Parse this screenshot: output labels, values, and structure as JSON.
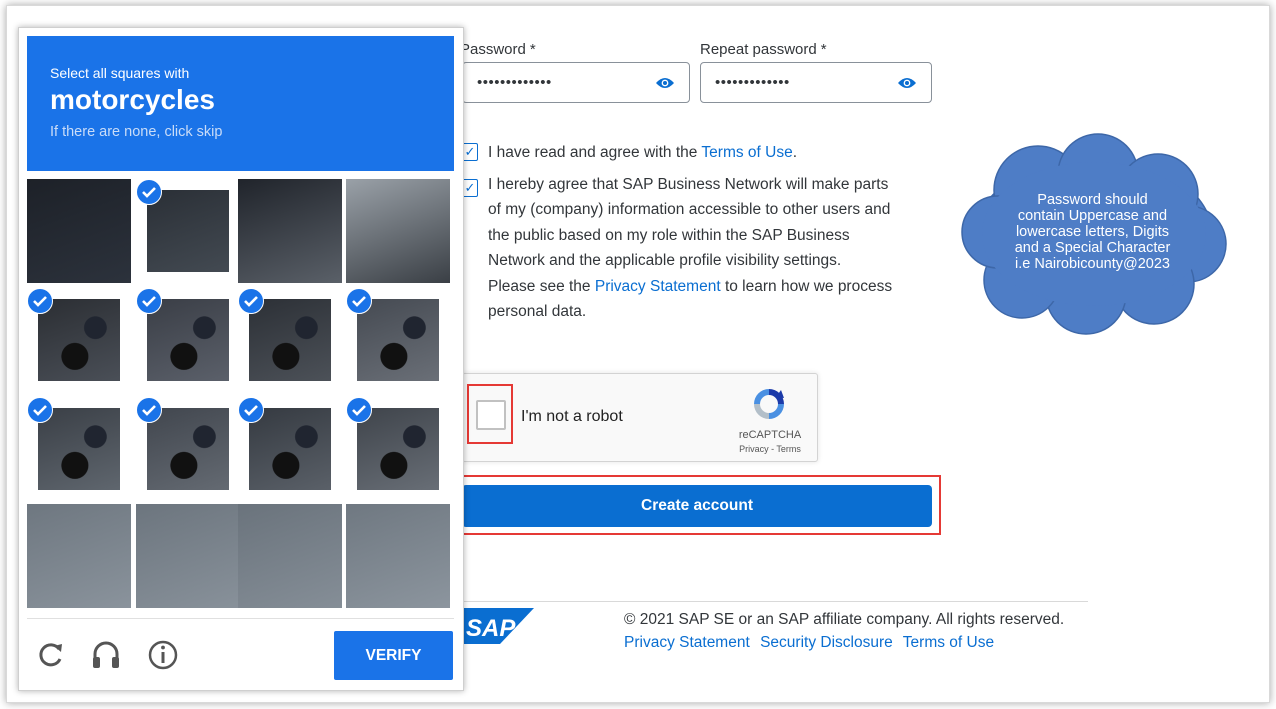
{
  "form": {
    "password_label": "Password",
    "password_required": "*",
    "password_value": "•••••••••••••",
    "repeat_label": "Repeat password",
    "repeat_required": "*",
    "repeat_value": "•••••••••••••",
    "checkbox_mark": "✓",
    "terms_prefix": "I have read and agree with the ",
    "terms_link": "Terms of Use",
    "terms_suffix": ".",
    "consent_lines": [
      "I hereby agree that SAP Business Network will make parts",
      "of my (company) information accessible to other users and",
      "the public based on my role within the SAP Business",
      "Network and the applicable profile visibility settings."
    ],
    "consent_see": "Please see the ",
    "consent_link": "Privacy Statement",
    "consent_after": " to learn how we process",
    "consent_last": "personal data.",
    "create_button": "Create account"
  },
  "recaptcha": {
    "label": "I'm not a robot",
    "brand": "reCAPTCHA",
    "links": "Privacy - Terms"
  },
  "footer": {
    "logo_text": "SAP",
    "copyright": "© 2021 SAP SE or an SAP affiliate company. All rights reserved.",
    "links": [
      "Privacy Statement",
      "Security Disclosure",
      "Terms of Use"
    ]
  },
  "note": {
    "lines": [
      "Password should",
      "contain Uppercase and",
      "lowercase letters, Digits",
      "and a Special Character",
      "i.e Nairobicounty@2023"
    ]
  },
  "challenge": {
    "instruction": "Select all squares with",
    "target": "motorcycles",
    "hint": "If there are none, click skip",
    "selected": [
      [
        false,
        true,
        false,
        false
      ],
      [
        true,
        true,
        true,
        true
      ],
      [
        true,
        true,
        true,
        true
      ],
      [
        false,
        false,
        false,
        false
      ]
    ],
    "verify_button": "VERIFY",
    "icons": [
      "reload-icon",
      "audio-icon",
      "info-icon"
    ]
  },
  "colors": {
    "sap_blue": "#0a6ed1",
    "captcha_blue": "#1a73e8",
    "highlight_red": "#e53935",
    "cloud_blue": "#4e7dc6"
  }
}
